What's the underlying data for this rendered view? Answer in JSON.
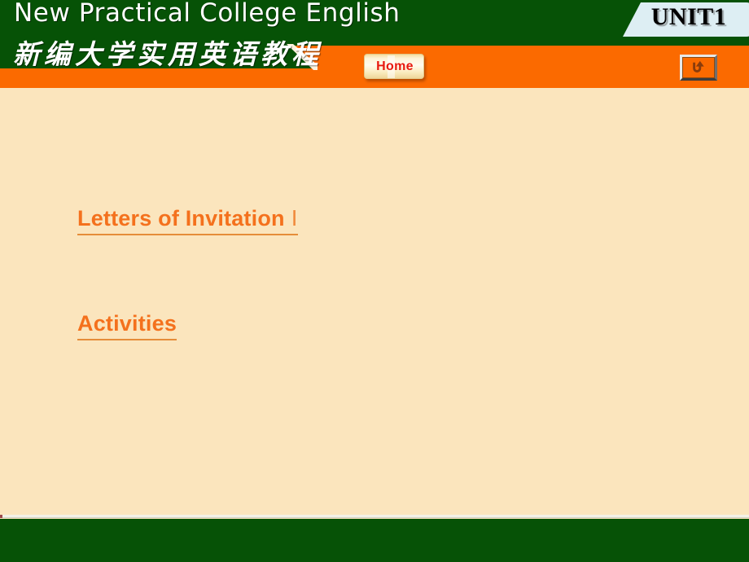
{
  "header": {
    "title_en": "New Practical College English",
    "title_cn": "新编大学实用英语教程",
    "unit_badge": "UNIT1",
    "home_button": "Home",
    "return_button_icon": "return-arrow-icon",
    "colors": {
      "green": "#065206",
      "orange": "#fb6a00",
      "badge_bg": "#ddeef3",
      "home_text": "#e8190f"
    }
  },
  "content": {
    "background": "#fbe5bd",
    "links": [
      {
        "label": "Letters of  Invitation",
        "suffix": "Ⅰ"
      },
      {
        "label": "Activities",
        "suffix": ""
      }
    ],
    "link_color": "#f4711d"
  },
  "footer": {
    "color": "#065206"
  }
}
